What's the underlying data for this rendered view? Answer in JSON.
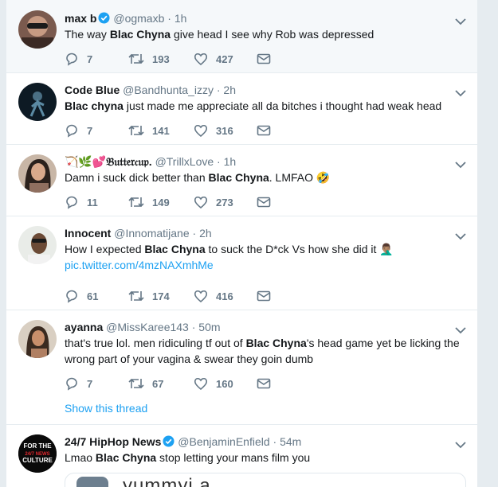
{
  "tweets": [
    {
      "name": "max b",
      "verified": true,
      "handle": "@ogmaxb",
      "time": "1h",
      "text_parts": [
        {
          "t": "The way ",
          "b": false
        },
        {
          "t": "Blac Chyna",
          "b": true
        },
        {
          "t": " give head I see why Rob was depressed",
          "b": false
        }
      ],
      "replies": "7",
      "retweets": "193",
      "likes": "427"
    },
    {
      "name": "Code Blue",
      "verified": false,
      "handle": "@Bandhunta_izzy",
      "time": "2h",
      "text_parts": [
        {
          "t": "Blac chyna",
          "b": true
        },
        {
          "t": " just made me appreciate all da bitches i thought had weak head",
          "b": false
        }
      ],
      "replies": "7",
      "retweets": "141",
      "likes": "316"
    },
    {
      "name": "🏹🌿💕𝔅𝔲𝔱𝔱𝔢𝔯𝔠𝔲𝔭.",
      "verified": false,
      "handle": "@TrillxLove",
      "time": "1h",
      "text_parts": [
        {
          "t": "Damn i suck dick better than ",
          "b": false
        },
        {
          "t": "Blac Chyna",
          "b": true
        },
        {
          "t": ". LMFAO 🤣",
          "b": false
        }
      ],
      "replies": "11",
      "retweets": "149",
      "likes": "273"
    },
    {
      "name": "Innocent",
      "verified": false,
      "handle": "@Innomatijane",
      "time": "2h",
      "text_parts": [
        {
          "t": "How I expected ",
          "b": false
        },
        {
          "t": "Blac Chyna",
          "b": true
        },
        {
          "t": " to suck the D*ck Vs how she did it 🤦🏽‍♂️",
          "b": false
        }
      ],
      "link": "pic.twitter.com/4mzNAXmhMe",
      "replies": "61",
      "retweets": "174",
      "likes": "416"
    },
    {
      "name": "ayanna",
      "verified": false,
      "handle": "@MissKaree143",
      "time": "50m",
      "text_parts": [
        {
          "t": "that's true lol. men ridiculing tf out of ",
          "b": false
        },
        {
          "t": "Blac Chyna",
          "b": true
        },
        {
          "t": "'s head game yet be licking the wrong part of your vagina & swear they goin dumb",
          "b": false
        }
      ],
      "replies": "7",
      "retweets": "67",
      "likes": "160",
      "show_thread": "Show this thread"
    },
    {
      "name": "24/7 HipHop News",
      "verified": true,
      "handle": "@BenjaminEnfield",
      "time": "54m",
      "text_parts": [
        {
          "t": "Lmao ",
          "b": false
        },
        {
          "t": "Blac Chyna",
          "b": true
        },
        {
          "t": " stop letting your mans film you",
          "b": false
        }
      ],
      "card_text": "yummyi.a",
      "avatar_text": "FOR THE 24/7 NEWS CULTURE"
    }
  ],
  "colors": {
    "link": "#1da1f2",
    "muted": "#657786",
    "verified": "#1da1f2",
    "divider": "#e6ecf0"
  },
  "icons": {
    "reply": "reply-icon",
    "retweet": "retweet-icon",
    "like": "heart-icon",
    "dm": "envelope-icon",
    "more": "chevron-down-icon",
    "verified": "verified-badge-icon"
  }
}
